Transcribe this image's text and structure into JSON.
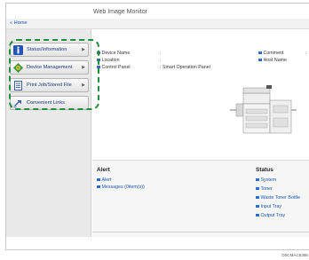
{
  "header": {
    "title": "Web Image Monitor"
  },
  "nav": {
    "home": "Home"
  },
  "sidebar": {
    "items": [
      {
        "label": "Status/Information",
        "icon": "info-icon",
        "has_arrow": true
      },
      {
        "label": "Device Management",
        "icon": "device-management-icon",
        "has_arrow": true
      },
      {
        "label": "Print Job/Stored File",
        "icon": "document-icon",
        "has_arrow": true
      },
      {
        "label": "Convenient Links",
        "icon": "link-icon",
        "has_arrow": false
      }
    ],
    "arrow_glyph": "▶"
  },
  "device_info": {
    "device_name_label": "Device Name",
    "device_name_sep": ":",
    "location_label": "Location",
    "location_sep": ":",
    "control_panel_label": "Control Panel",
    "control_panel_value": ": Smart Operation Panel",
    "comment_label": "Comment",
    "comment_sep": ":",
    "host_name_label": "Host Name"
  },
  "alert": {
    "title": "Alert",
    "items": [
      "Alert",
      "Messages (0item(s))"
    ]
  },
  "status": {
    "title": "Status",
    "items": [
      "System",
      "Toner",
      "Waste Toner Bottle",
      "Input Tray",
      "Output Tray"
    ]
  },
  "image_code": "D0CMAC6366",
  "colors": {
    "accent": "#1a56b0",
    "bullet": "#2a6fd0",
    "highlight": "#1f8f3a",
    "sidebar_bg": "#e9e9e9"
  }
}
